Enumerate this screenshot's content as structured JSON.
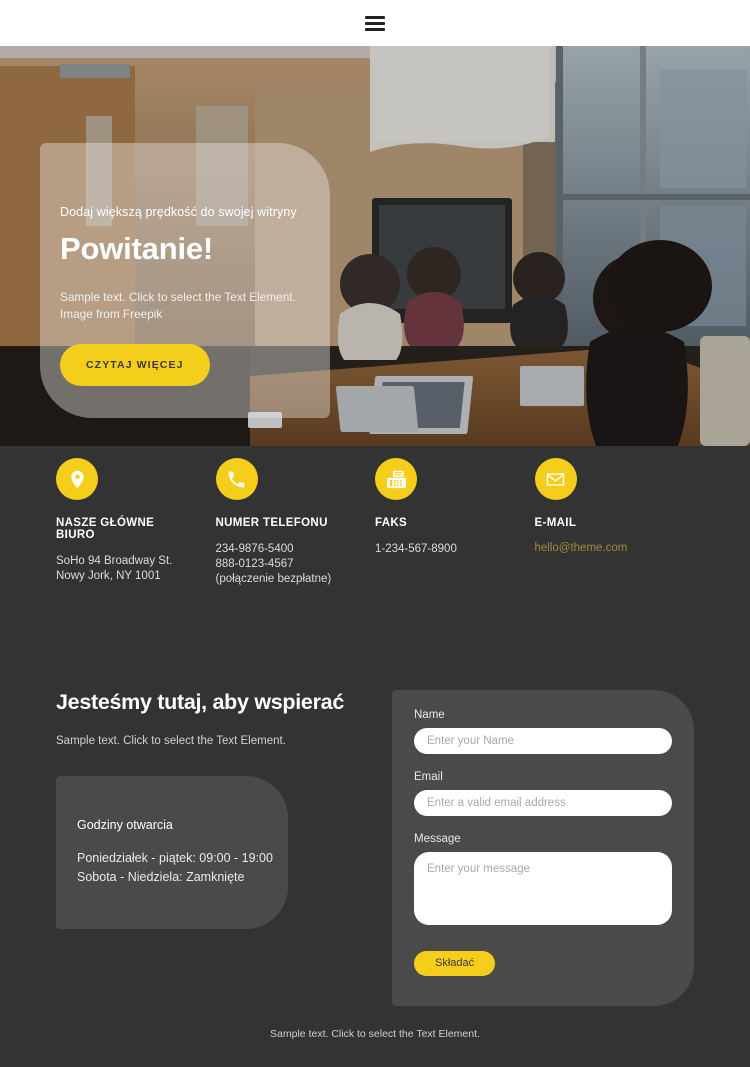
{
  "header": {
    "menu_icon": "hamburger-icon"
  },
  "hero": {
    "kicker": "Dodaj większą prędkość do swojej witryny",
    "title": "Powitanie!",
    "description": "Sample text. Click to select the Text Element.\nImage from Freepik",
    "cta_label": "CZYTAJ WIĘCEJ"
  },
  "contacts": [
    {
      "icon": "map-pin-icon",
      "title": "NASZE GŁÓWNE BIURO",
      "line1": "SoHo 94 Broadway St.",
      "line2": "Nowy Jork, NY 1001"
    },
    {
      "icon": "phone-icon",
      "title": "NUMER TELEFONU",
      "line1": "234-9876-5400",
      "line2": "888-0123-4567 (połączenie bezpłatne)"
    },
    {
      "icon": "fax-icon",
      "title": "FAKS",
      "line1": "1-234-567-8900",
      "line2": ""
    },
    {
      "icon": "envelope-icon",
      "title": "E-MAIL",
      "email": "hello@theme.com"
    }
  ],
  "support": {
    "title": "Jesteśmy tutaj, aby wspierać",
    "subtitle": "Sample text. Click to select the Text Element.",
    "hours": {
      "title": "Godziny otwarcia",
      "weekdays": "Poniedziałek - piątek: 09:00 - 19:00",
      "weekend": "Sobota - Niedziela: Zamknięte"
    }
  },
  "form": {
    "name_label": "Name",
    "name_placeholder": "Enter your Name",
    "email_label": "Email",
    "email_placeholder": "Enter a valid email address",
    "message_label": "Message",
    "message_placeholder": "Enter your message",
    "submit_label": "Składać"
  },
  "footer": {
    "text": "Sample text. Click to select the Text Element."
  },
  "colors": {
    "accent": "#F5CE1C",
    "page_bg": "#333333",
    "card_bg": "#4A4A4A",
    "link": "#A08A3C"
  }
}
